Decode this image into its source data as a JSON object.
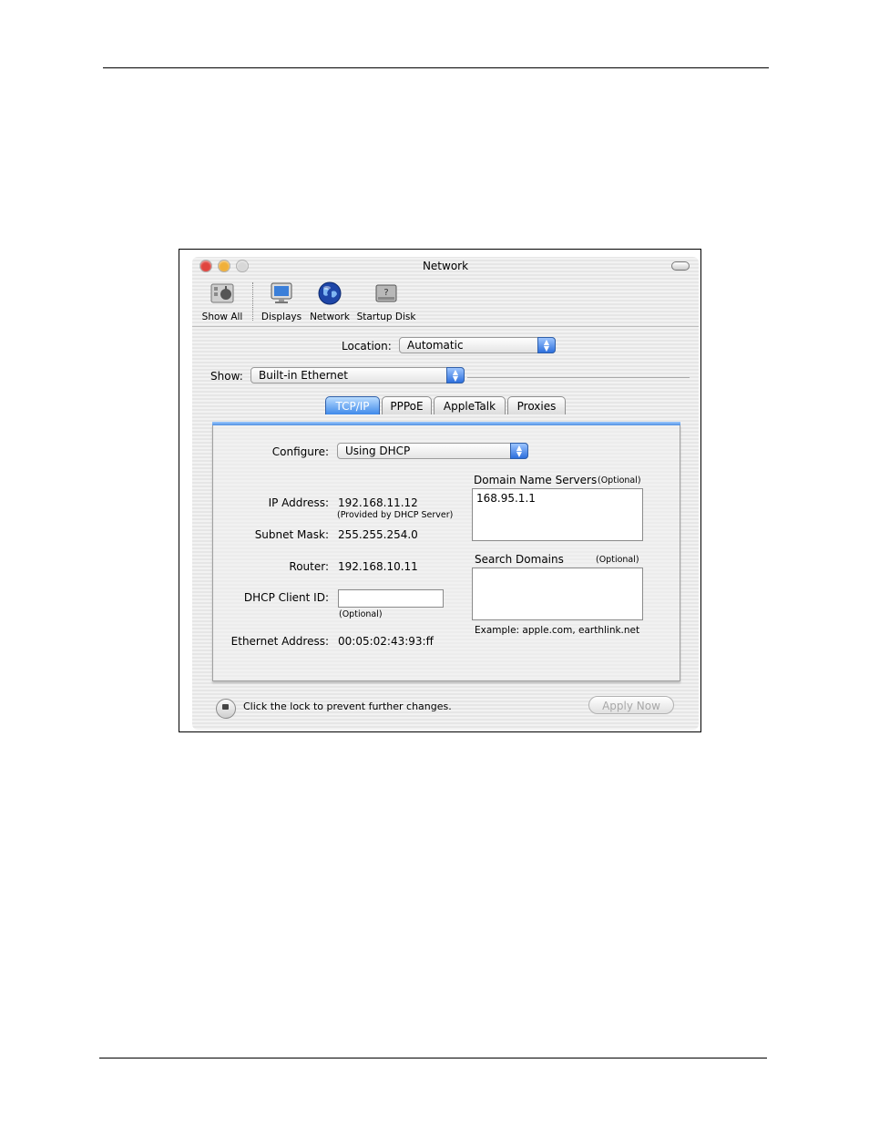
{
  "window": {
    "title": "Network"
  },
  "toolbar": {
    "items": [
      {
        "label": "Show All",
        "icon": "apple-icon"
      },
      {
        "label": "Displays",
        "icon": "monitor-icon"
      },
      {
        "label": "Network",
        "icon": "globe-icon"
      },
      {
        "label": "Startup Disk",
        "icon": "disk-icon"
      }
    ]
  },
  "location": {
    "label": "Location:",
    "value": "Automatic"
  },
  "show": {
    "label": "Show:",
    "value": "Built-in Ethernet"
  },
  "tabs": [
    {
      "label": "TCP/IP",
      "active": true
    },
    {
      "label": "PPPoE",
      "active": false
    },
    {
      "label": "AppleTalk",
      "active": false
    },
    {
      "label": "Proxies",
      "active": false
    }
  ],
  "tcpip": {
    "configure_label": "Configure:",
    "configure_value": "Using DHCP",
    "ip_label": "IP Address:",
    "ip_value": "192.168.11.12",
    "ip_note": "(Provided by DHCP Server)",
    "subnet_label": "Subnet Mask:",
    "subnet_value": "255.255.254.0",
    "router_label": "Router:",
    "router_value": "192.168.10.11",
    "dhcp_id_label": "DHCP Client ID:",
    "dhcp_id_value": "",
    "dhcp_id_note": "(Optional)",
    "ethernet_label": "Ethernet Address:",
    "ethernet_value": "00:05:02:43:93:ff",
    "dns_label": "Domain Name Servers",
    "dns_optional": "(Optional)",
    "dns_value": "168.95.1.1",
    "search_label": "Search Domains",
    "search_optional": "(Optional)",
    "search_value": "",
    "example": "Example: apple.com, earthlink.net"
  },
  "footer": {
    "lock_text": "Click the lock to prevent further changes.",
    "apply_label": "Apply Now"
  },
  "colors": {
    "accent": "#3f8aea",
    "close": "#e0443e",
    "minimize": "#f0b03a"
  }
}
